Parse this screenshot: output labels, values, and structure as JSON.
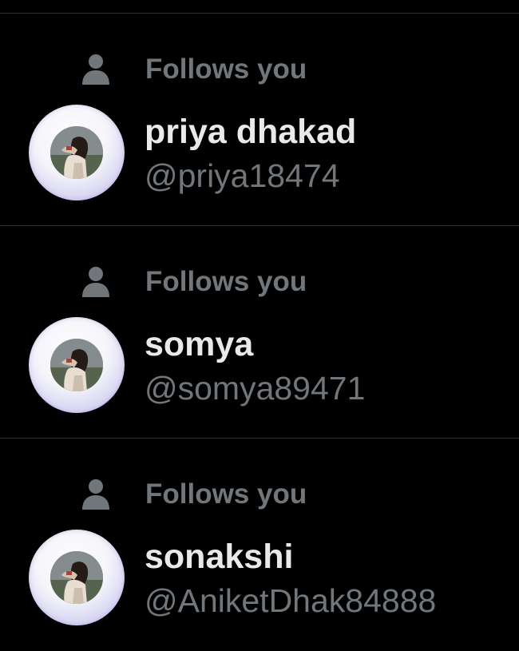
{
  "followers": [
    {
      "context": "Follows you",
      "context_icon": "person-icon",
      "name": "priya dhakad",
      "handle": "@priya18474"
    },
    {
      "context": "Follows you",
      "context_icon": "person-icon",
      "name": "somya",
      "handle": "@somya89471"
    },
    {
      "context": "Follows you",
      "context_icon": "person-icon",
      "name": "sonakshi",
      "handle": "@AniketDhak84888"
    }
  ],
  "colors": {
    "background": "#000000",
    "primary_text": "#e7e9ea",
    "secondary_text": "#71767b",
    "divider": "#2f3336"
  }
}
